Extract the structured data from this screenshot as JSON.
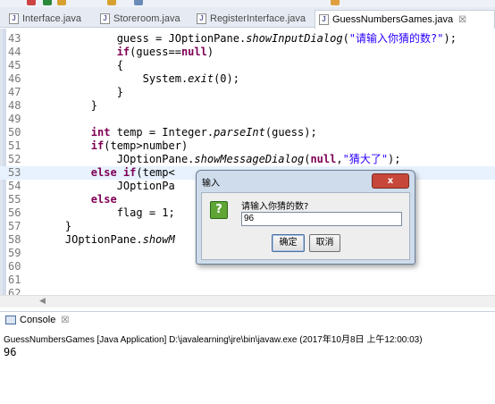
{
  "tabs": [
    {
      "label": "Interface.java",
      "active": false
    },
    {
      "label": "Storeroom.java",
      "active": false
    },
    {
      "label": "RegisterInterface.java",
      "active": false
    },
    {
      "label": "GuessNumbersGames.java",
      "active": true,
      "close": "☒"
    }
  ],
  "editor": {
    "lines": [
      {
        "n": "43"
      },
      {
        "n": "44"
      },
      {
        "n": "45"
      },
      {
        "n": "46"
      },
      {
        "n": "47"
      },
      {
        "n": "48"
      },
      {
        "n": "49"
      },
      {
        "n": "50"
      },
      {
        "n": "51"
      },
      {
        "n": "52"
      },
      {
        "n": "53"
      },
      {
        "n": "54"
      },
      {
        "n": "55"
      },
      {
        "n": "56"
      },
      {
        "n": "57"
      },
      {
        "n": "58"
      },
      {
        "n": "59"
      },
      {
        "n": "60"
      },
      {
        "n": "61"
      },
      {
        "n": "62"
      }
    ]
  },
  "console": {
    "tab_label": "Console",
    "tab_close": "☒",
    "status": "GuessNumbersGames [Java Application] D:\\javalearning\\jre\\bin\\javaw.exe (2017年10月8日 上午12:00:03)",
    "output": "96"
  },
  "dialog": {
    "title": "输入",
    "close_label": "x",
    "icon": "question-icon",
    "icon_glyph": "?",
    "prompt": "请输入你猜的数?",
    "input_value": "96",
    "ok_label": "确定",
    "cancel_label": "取消"
  },
  "colors": {
    "keyword": "#7f0055",
    "string": "#2a00ff",
    "current_line": "#e8f2fe",
    "dialog_close": "#c7483a"
  }
}
